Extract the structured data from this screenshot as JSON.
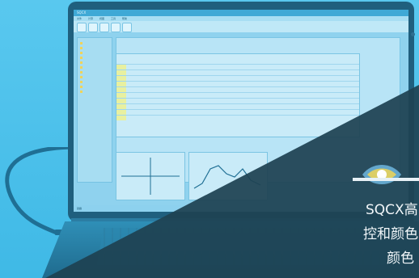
{
  "app": {
    "title": "SQCX",
    "menu_items": [
      "文件",
      "计算",
      "视图",
      "工具",
      "帮助"
    ],
    "status_text": "就绪"
  },
  "overlay": {
    "lines": [
      "SQCX高",
      "控和颜色",
      "颜色"
    ]
  }
}
